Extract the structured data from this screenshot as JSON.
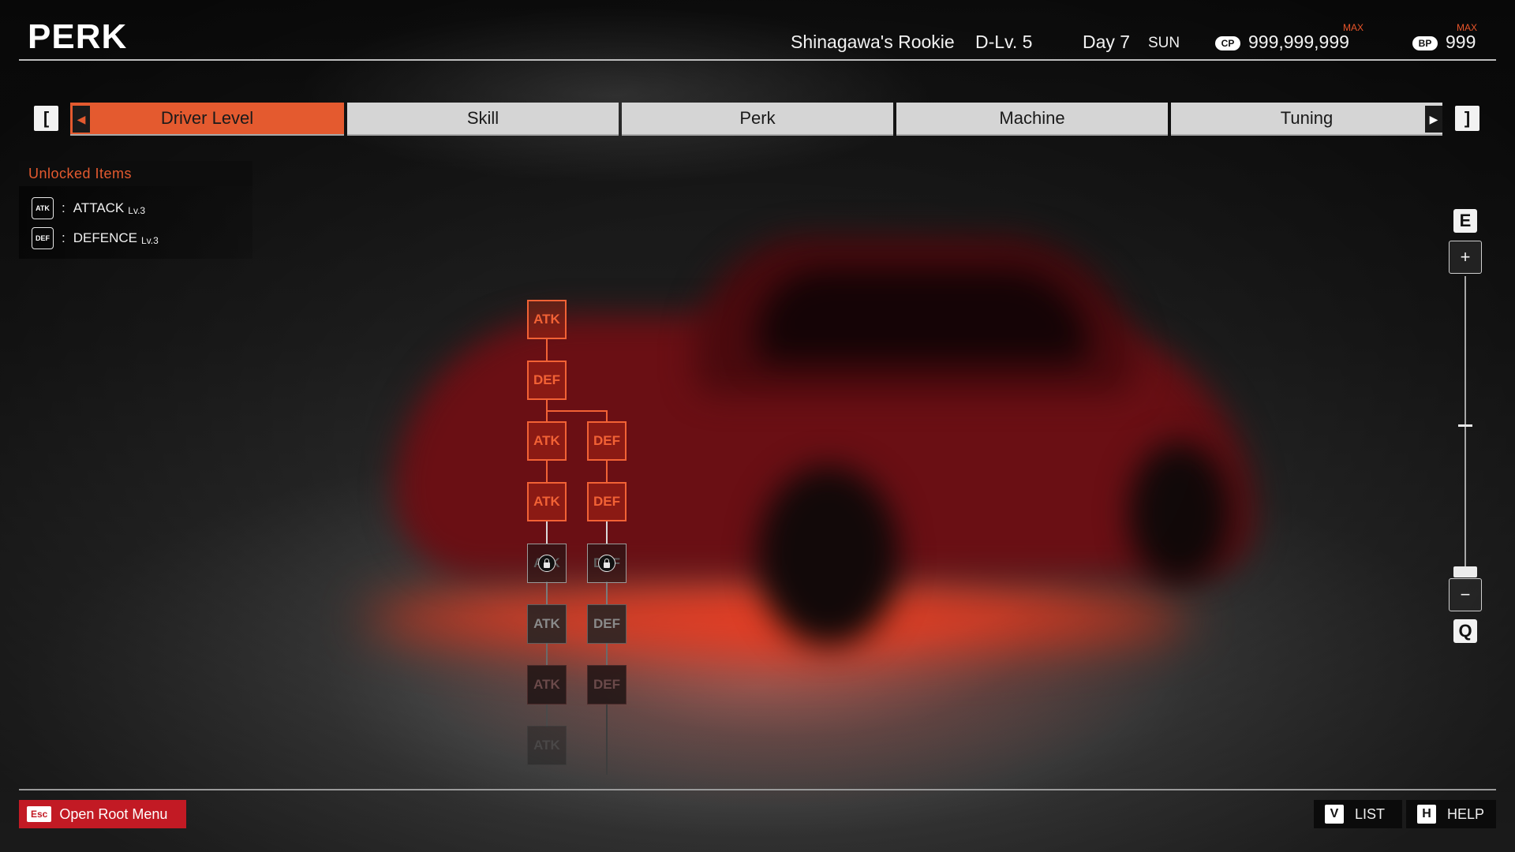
{
  "header": {
    "title": "PERK",
    "driver_title": "Shinagawa's Rookie",
    "driver_level": "D-Lv. 5",
    "day": "Day 7",
    "weekday": "SUN",
    "cp_icon": "CP",
    "cp_value": "999,999,999",
    "cp_max": "MAX",
    "bp_icon": "BP",
    "bp_value": "999",
    "bp_max": "MAX"
  },
  "tabs": {
    "prev_key": "[",
    "next_key": "]",
    "items": [
      {
        "label": "Driver Level",
        "active": true
      },
      {
        "label": "Skill",
        "active": false
      },
      {
        "label": "Perk",
        "active": false
      },
      {
        "label": "Machine",
        "active": false
      },
      {
        "label": "Tuning",
        "active": false
      }
    ]
  },
  "unlocked": {
    "title": "Unlocked Items",
    "items": [
      {
        "icon": "ATK",
        "name": "ATTACK",
        "level": "Lv.3"
      },
      {
        "icon": "DEF",
        "name": "DEFENCE",
        "level": "Lv.3"
      }
    ]
  },
  "tree": {
    "col1": [
      "ATK",
      "DEF",
      "ATK",
      "ATK",
      "ATK",
      "ATK",
      "ATK",
      "ATK"
    ],
    "col2": [
      "DEF",
      "DEF",
      "DEF",
      "DEF",
      "DEF"
    ]
  },
  "zoom": {
    "key_in": "E",
    "key_out": "Q",
    "plus": "+",
    "minus": "−"
  },
  "footer": {
    "esc_key": "Esc",
    "esc_label": "Open Root Menu",
    "list_key": "V",
    "list_label": "LIST",
    "help_key": "H",
    "help_label": "HELP"
  },
  "colors": {
    "accent": "#e45a2f",
    "esc_red": "#c21a24",
    "car_red": "#6a0f14"
  }
}
